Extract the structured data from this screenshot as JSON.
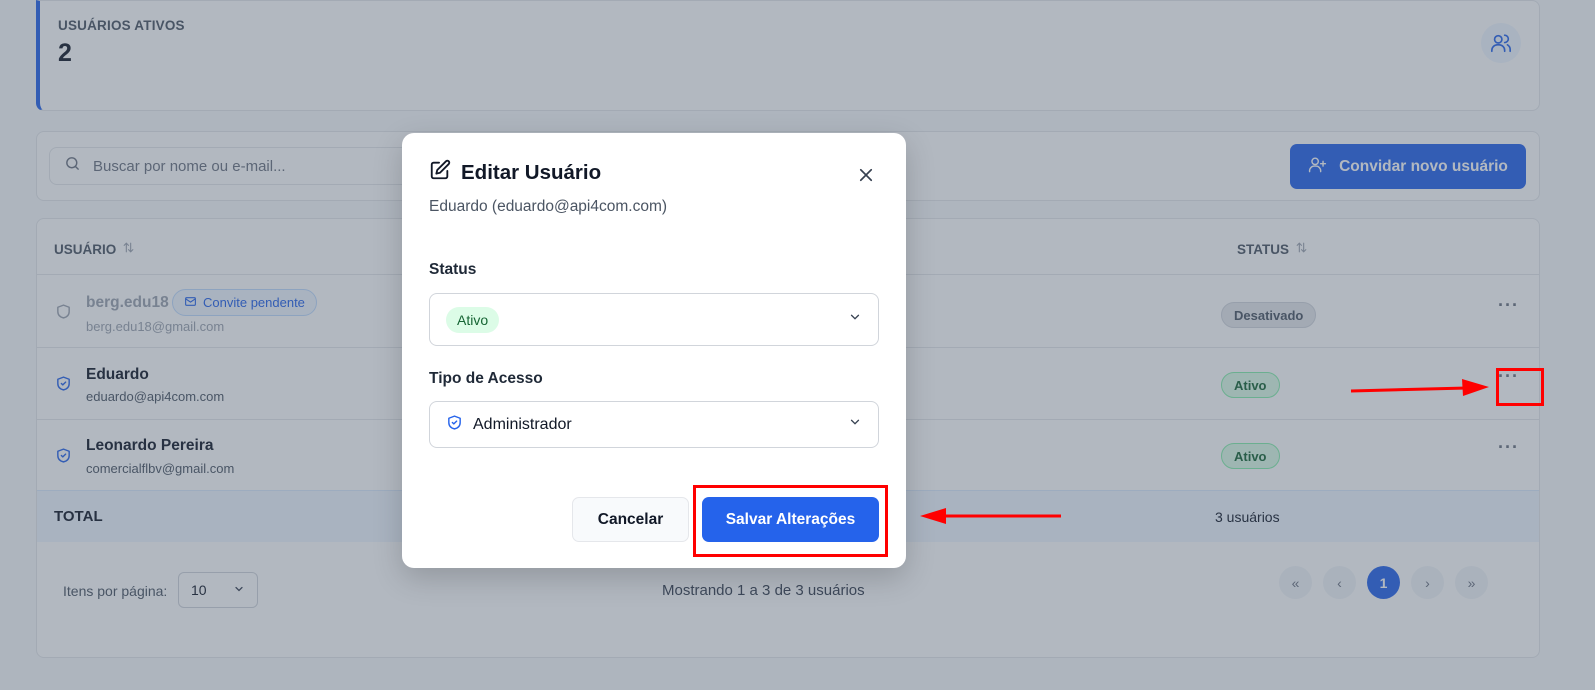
{
  "stats": {
    "active_label": "USUÁRIOS ATIVOS",
    "active_value": "2"
  },
  "toolbar": {
    "search_placeholder": "Buscar por nome ou e-mail...",
    "invite_label": "Convidar novo usuário"
  },
  "table": {
    "headers": {
      "user": "USUÁRIO",
      "status": "STATUS"
    },
    "rows": [
      {
        "name": "berg.edu18",
        "email": "berg.edu18@gmail.com",
        "badge": "Convite pendente",
        "status": "Desativado"
      },
      {
        "name": "Eduardo",
        "email": "eduardo@api4com.com",
        "status": "Ativo"
      },
      {
        "name": "Leonardo Pereira",
        "email": "comercialflbv@gmail.com",
        "status": "Ativo"
      }
    ],
    "total": {
      "label": "TOTAL",
      "count": "3 usuários"
    }
  },
  "pagination": {
    "per_page_label": "Itens por página:",
    "per_page_value": "10",
    "showing": "Mostrando 1 a 3 de 3 usuários",
    "first": "«",
    "prev": "‹",
    "current": "1",
    "next": "›",
    "last": "»"
  },
  "modal": {
    "title": "Editar Usuário",
    "subtitle": "Eduardo (eduardo@api4com.com)",
    "status_label": "Status",
    "status_value": "Ativo",
    "access_label": "Tipo de Acesso",
    "access_value": "Administrador",
    "cancel_label": "Cancelar",
    "save_label": "Salvar Alterações"
  },
  "colors": {
    "primary": "#2563eb",
    "annotation": "#ff0000"
  },
  "icons": [
    "users-icon",
    "search-icon",
    "user-plus-icon",
    "sort-icon",
    "shield-icon",
    "mail-icon",
    "more-icon",
    "edit-icon",
    "close-icon",
    "chevron-down-icon",
    "shield-check-icon"
  ]
}
